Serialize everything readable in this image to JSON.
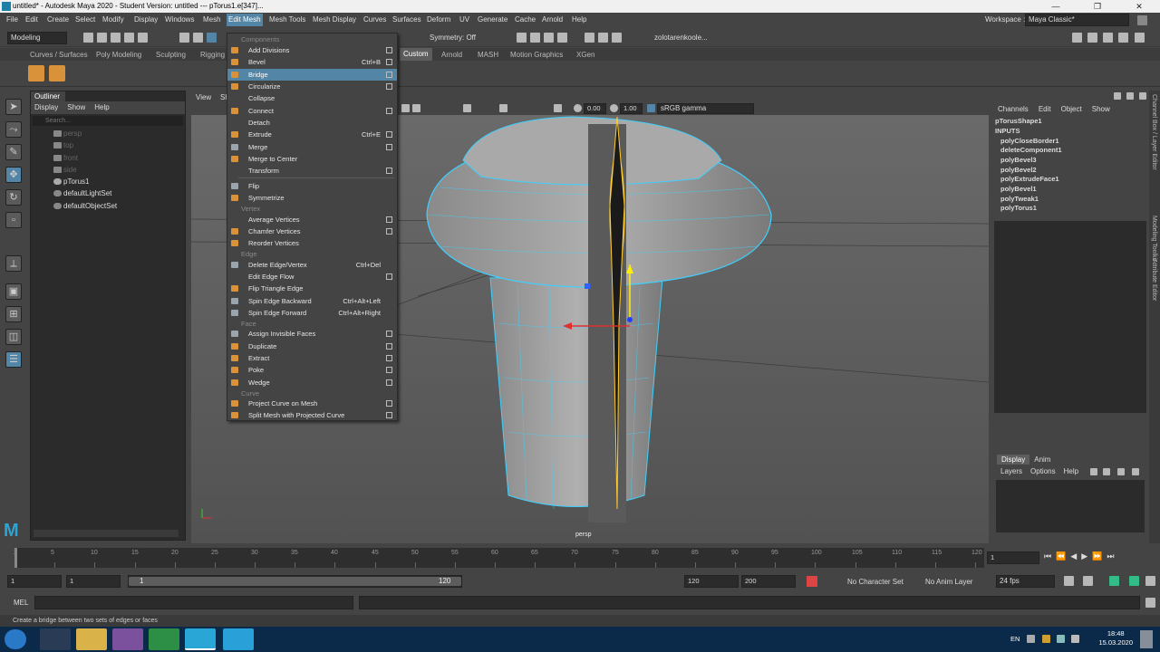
{
  "window": {
    "title": "untitled* - Autodesk Maya 2020 - Student Version: untitled  ---  pTorus1.e[347]...",
    "minimize": "—",
    "maximize": "❐",
    "close": "✕"
  },
  "menubar": {
    "items": [
      "File",
      "Edit",
      "Create",
      "Select",
      "Modify",
      "Display",
      "Windows",
      "Mesh",
      "Edit Mesh",
      "Mesh Tools",
      "Mesh Display",
      "Curves",
      "Surfaces",
      "Deform",
      "UV",
      "Generate",
      "Cache",
      "Arnold",
      "Help"
    ],
    "active": "Edit Mesh",
    "workspace_label": "Workspace :",
    "workspace_value": "Maya Classic*"
  },
  "toolbar": {
    "mode": "Modeling",
    "symmetry": "Symmetry: Off",
    "user": "zolotarenkoole..."
  },
  "shelf": {
    "tabs": [
      "Curves / Surfaces",
      "Poly Modeling",
      "Sculpting",
      "Rigging",
      "Custom",
      "Arnold",
      "MASH",
      "Motion Graphics",
      "XGen"
    ],
    "selected": "Custom"
  },
  "outliner": {
    "title": "Outliner",
    "menu": [
      "Display",
      "Show",
      "Help"
    ],
    "search_placeholder": "Search...",
    "items": [
      {
        "label": "persp",
        "dim": true
      },
      {
        "label": "top",
        "dim": true
      },
      {
        "label": "front",
        "dim": true
      },
      {
        "label": "side",
        "dim": true
      },
      {
        "label": "pTorus1",
        "dim": false
      },
      {
        "label": "defaultLightSet",
        "dim": false
      },
      {
        "label": "defaultObjectSet",
        "dim": false
      }
    ]
  },
  "viewport": {
    "menu": [
      "View",
      "Sh"
    ],
    "exposure": "0.00",
    "gamma": "1.00",
    "color_space": "sRGB gamma",
    "camera_label": "persp"
  },
  "edit_mesh_menu": {
    "sections": [
      {
        "name": "Components",
        "items": [
          {
            "label": "Add Divisions",
            "shortcut": "",
            "option": true,
            "highlighted": false
          },
          {
            "label": "Bevel",
            "shortcut": "Ctrl+B",
            "option": true,
            "highlighted": false
          },
          {
            "label": "Bridge",
            "shortcut": "",
            "option": true,
            "highlighted": true
          },
          {
            "label": "Circularize",
            "shortcut": "",
            "option": true,
            "highlighted": false
          },
          {
            "label": "Collapse",
            "shortcut": "",
            "option": false,
            "highlighted": false
          },
          {
            "label": "Connect",
            "shortcut": "",
            "option": true,
            "highlighted": false
          },
          {
            "label": "Detach",
            "shortcut": "",
            "option": false,
            "highlighted": false
          },
          {
            "label": "Extrude",
            "shortcut": "Ctrl+E",
            "option": true,
            "highlighted": false
          },
          {
            "label": "Merge",
            "shortcut": "",
            "option": true,
            "highlighted": false
          },
          {
            "label": "Merge to Center",
            "shortcut": "",
            "option": false,
            "highlighted": false
          },
          {
            "label": "Transform",
            "shortcut": "",
            "option": true,
            "highlighted": false
          },
          {
            "label": "Flip",
            "shortcut": "",
            "option": false,
            "highlighted": false
          },
          {
            "label": "Symmetrize",
            "shortcut": "",
            "option": false,
            "highlighted": false
          }
        ]
      },
      {
        "name": "Vertex",
        "items": [
          {
            "label": "Average Vertices",
            "shortcut": "",
            "option": true,
            "highlighted": false
          },
          {
            "label": "Chamfer Vertices",
            "shortcut": "",
            "option": true,
            "highlighted": false
          },
          {
            "label": "Reorder Vertices",
            "shortcut": "",
            "option": false,
            "highlighted": false
          }
        ]
      },
      {
        "name": "Edge",
        "items": [
          {
            "label": "Delete Edge/Vertex",
            "shortcut": "Ctrl+Del",
            "option": false,
            "highlighted": false
          },
          {
            "label": "Edit Edge Flow",
            "shortcut": "",
            "option": true,
            "highlighted": false
          },
          {
            "label": "Flip Triangle Edge",
            "shortcut": "",
            "option": false,
            "highlighted": false
          },
          {
            "label": "Spin Edge Backward",
            "shortcut": "Ctrl+Alt+Left",
            "option": false,
            "highlighted": false
          },
          {
            "label": "Spin Edge Forward",
            "shortcut": "Ctrl+Alt+Right",
            "option": false,
            "highlighted": false
          }
        ]
      },
      {
        "name": "Face",
        "items": [
          {
            "label": "Assign Invisible Faces",
            "shortcut": "",
            "option": true,
            "highlighted": false
          },
          {
            "label": "Duplicate",
            "shortcut": "",
            "option": true,
            "highlighted": false
          },
          {
            "label": "Extract",
            "shortcut": "",
            "option": true,
            "highlighted": false
          },
          {
            "label": "Poke",
            "shortcut": "",
            "option": true,
            "highlighted": false
          },
          {
            "label": "Wedge",
            "shortcut": "",
            "option": true,
            "highlighted": false
          }
        ]
      },
      {
        "name": "Curve",
        "items": [
          {
            "label": "Project Curve on Mesh",
            "shortcut": "",
            "option": true,
            "highlighted": false
          },
          {
            "label": "Split Mesh with Projected Curve",
            "shortcut": "",
            "option": true,
            "highlighted": false
          }
        ]
      }
    ]
  },
  "channel_box": {
    "menu": [
      "Channels",
      "Edit",
      "Object",
      "Show"
    ],
    "shape": "pTorusShape1",
    "inputs_label": "INPUTS",
    "inputs": [
      "polyCloseBorder1",
      "deleteComponent1",
      "polyBevel3",
      "polyBevel2",
      "polyExtrudeFace1",
      "polyBevel1",
      "polyTweak1",
      "polyTorus1"
    ]
  },
  "layer_editor": {
    "tabs": [
      "Display",
      "Anim"
    ],
    "menu": [
      "Layers",
      "Options",
      "Help"
    ]
  },
  "side_tabs": [
    "Channel Box / Layer Editor",
    "Modeling Toolkit",
    "Attribute Editor"
  ],
  "timeline": {
    "ticks": [
      "5",
      "10",
      "15",
      "20",
      "25",
      "30",
      "35",
      "40",
      "45",
      "50",
      "55",
      "60",
      "65",
      "70",
      "75",
      "80",
      "85",
      "90",
      "95",
      "100",
      "105",
      "110",
      "115",
      "120"
    ],
    "start_tick": "1",
    "current_frame": "1"
  },
  "range": {
    "start": "1",
    "start2": "1",
    "slider_start": "1",
    "slider_end": "120",
    "end": "120",
    "end2": "200",
    "character_set": "No Character Set",
    "anim_layer": "No Anim Layer",
    "fps": "24 fps"
  },
  "mel": {
    "label": "MEL"
  },
  "help_line": "Create a bridge between two sets of edges or faces",
  "taskbar": {
    "language": "EN",
    "time": "18:48",
    "date": "15.03.2020"
  }
}
